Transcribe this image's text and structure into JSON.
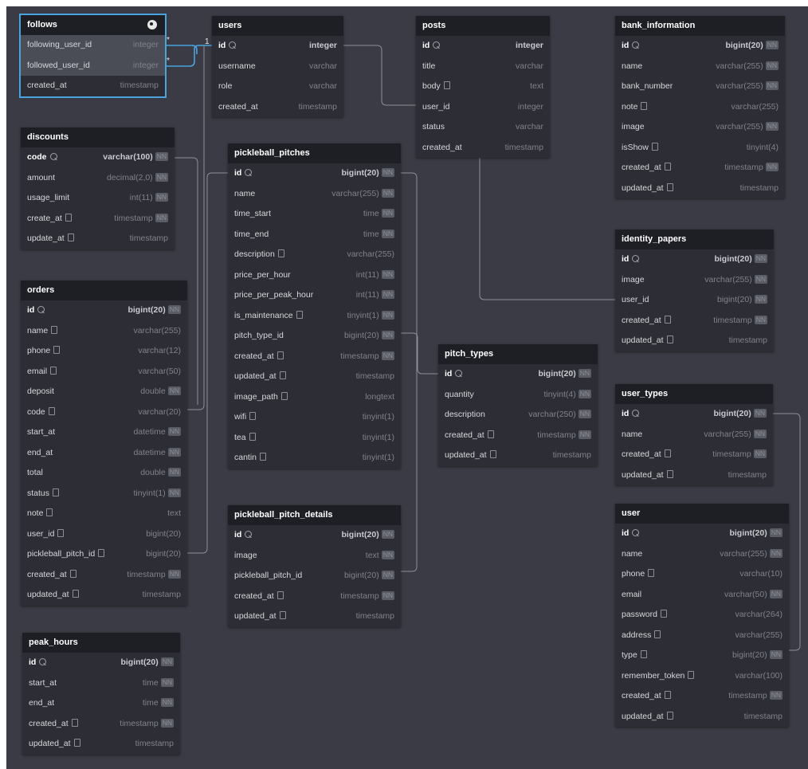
{
  "relation_labels": [
    {
      "text": "*"
    },
    {
      "text": "*"
    },
    {
      "text": "1"
    }
  ],
  "tables": [
    {
      "id": "follows",
      "name": "follows",
      "selected": true,
      "palette_icon": "palette-icon",
      "fields": [
        {
          "name": "following_user_id",
          "type": "integer",
          "highlight": true
        },
        {
          "name": "followed_user_id",
          "type": "integer",
          "highlight": true
        },
        {
          "name": "created_at",
          "type": "timestamp"
        }
      ]
    },
    {
      "id": "users",
      "name": "users",
      "fields": [
        {
          "name": "id",
          "type": "integer",
          "pk": true,
          "key": true
        },
        {
          "name": "username",
          "type": "varchar"
        },
        {
          "name": "role",
          "type": "varchar"
        },
        {
          "name": "created_at",
          "type": "timestamp"
        }
      ]
    },
    {
      "id": "posts",
      "name": "posts",
      "fields": [
        {
          "name": "id",
          "type": "integer",
          "pk": true,
          "key": true
        },
        {
          "name": "title",
          "type": "varchar"
        },
        {
          "name": "body",
          "type": "text",
          "note": true
        },
        {
          "name": "user_id",
          "type": "integer"
        },
        {
          "name": "status",
          "type": "varchar"
        },
        {
          "name": "created_at",
          "type": "timestamp"
        }
      ]
    },
    {
      "id": "bank_information",
      "name": "bank_information",
      "fields": [
        {
          "name": "id",
          "type": "bigint(20)",
          "pk": true,
          "key": true,
          "nn": "NN"
        },
        {
          "name": "name",
          "type": "varchar(255)",
          "nn": "NN"
        },
        {
          "name": "bank_number",
          "type": "varchar(255)",
          "nn": "NN"
        },
        {
          "name": "note",
          "type": "varchar(255)",
          "note": true
        },
        {
          "name": "image",
          "type": "varchar(255)",
          "nn": "NN"
        },
        {
          "name": "isShow",
          "type": "tinyint(4)",
          "note": true
        },
        {
          "name": "created_at",
          "type": "timestamp",
          "note": true,
          "nn": "NN"
        },
        {
          "name": "updated_at",
          "type": "timestamp",
          "note": true
        }
      ]
    },
    {
      "id": "discounts",
      "name": "discounts",
      "fields": [
        {
          "name": "code",
          "type": "varchar(100)",
          "pk": true,
          "key": true,
          "nn": "NN"
        },
        {
          "name": "amount",
          "type": "decimal(2,0)",
          "nn": "NN"
        },
        {
          "name": "usage_limit",
          "type": "int(11)",
          "nn": "NN"
        },
        {
          "name": "create_at",
          "type": "timestamp",
          "note": true,
          "nn": "NN"
        },
        {
          "name": "update_at",
          "type": "timestamp",
          "note": true
        }
      ]
    },
    {
      "id": "pickleball_pitches",
      "name": "pickleball_pitches",
      "fields": [
        {
          "name": "id",
          "type": "bigint(20)",
          "pk": true,
          "key": true,
          "nn": "NN"
        },
        {
          "name": "name",
          "type": "varchar(255)",
          "nn": "NN"
        },
        {
          "name": "time_start",
          "type": "time",
          "nn": "NN"
        },
        {
          "name": "time_end",
          "type": "time",
          "nn": "NN"
        },
        {
          "name": "description",
          "type": "varchar(255)",
          "note": true
        },
        {
          "name": "price_per_hour",
          "type": "int(11)",
          "nn": "NN"
        },
        {
          "name": "price_per_peak_hour",
          "type": "int(11)",
          "nn": "NN"
        },
        {
          "name": "is_maintenance",
          "type": "tinyint(1)",
          "note": true,
          "nn": "NN"
        },
        {
          "name": "pitch_type_id",
          "type": "bigint(20)",
          "nn": "NN"
        },
        {
          "name": "created_at",
          "type": "timestamp",
          "note": true,
          "nn": "NN"
        },
        {
          "name": "updated_at",
          "type": "timestamp",
          "note": true
        },
        {
          "name": "image_path",
          "type": "longtext",
          "note": true
        },
        {
          "name": "wifi",
          "type": "tinyint(1)",
          "note": true
        },
        {
          "name": "tea",
          "type": "tinyint(1)",
          "note": true
        },
        {
          "name": "cantin",
          "type": "tinyint(1)",
          "note": true
        }
      ]
    },
    {
      "id": "identity_papers",
      "name": "identity_papers",
      "fields": [
        {
          "name": "id",
          "type": "bigint(20)",
          "pk": true,
          "key": true,
          "nn": "NN"
        },
        {
          "name": "image",
          "type": "varchar(255)",
          "nn": "NN"
        },
        {
          "name": "user_id",
          "type": "bigint(20)",
          "nn": "NN"
        },
        {
          "name": "created_at",
          "type": "timestamp",
          "note": true,
          "nn": "NN"
        },
        {
          "name": "updated_at",
          "type": "timestamp",
          "note": true
        }
      ]
    },
    {
      "id": "orders",
      "name": "orders",
      "fields": [
        {
          "name": "id",
          "type": "bigint(20)",
          "pk": true,
          "key": true,
          "nn": "NN"
        },
        {
          "name": "name",
          "type": "varchar(255)",
          "note": true
        },
        {
          "name": "phone",
          "type": "varchar(12)",
          "note": true
        },
        {
          "name": "email",
          "type": "varchar(50)",
          "note": true
        },
        {
          "name": "deposit",
          "type": "double",
          "nn": "NN"
        },
        {
          "name": "code",
          "type": "varchar(20)",
          "note": true
        },
        {
          "name": "start_at",
          "type": "datetime",
          "nn": "NN"
        },
        {
          "name": "end_at",
          "type": "datetime",
          "nn": "NN"
        },
        {
          "name": "total",
          "type": "double",
          "nn": "NN"
        },
        {
          "name": "status",
          "type": "tinyint(1)",
          "note": true,
          "nn": "NN"
        },
        {
          "name": "note",
          "type": "text",
          "note": true
        },
        {
          "name": "user_id",
          "type": "bigint(20)",
          "note": true
        },
        {
          "name": "pickleball_pitch_id",
          "type": "bigint(20)",
          "note": true
        },
        {
          "name": "created_at",
          "type": "timestamp",
          "note": true,
          "nn": "NN"
        },
        {
          "name": "updated_at",
          "type": "timestamp",
          "note": true
        }
      ]
    },
    {
      "id": "pitch_types",
      "name": "pitch_types",
      "fields": [
        {
          "name": "id",
          "type": "bigint(20)",
          "pk": true,
          "key": true,
          "nn": "NN"
        },
        {
          "name": "quantity",
          "type": "tinyint(4)",
          "nn": "NN"
        },
        {
          "name": "description",
          "type": "varchar(250)",
          "nn": "NN"
        },
        {
          "name": "created_at",
          "type": "timestamp",
          "note": true,
          "nn": "NN"
        },
        {
          "name": "updated_at",
          "type": "timestamp",
          "note": true
        }
      ]
    },
    {
      "id": "user_types",
      "name": "user_types",
      "fields": [
        {
          "name": "id",
          "type": "bigint(20)",
          "pk": true,
          "key": true,
          "nn": "NN"
        },
        {
          "name": "name",
          "type": "varchar(255)",
          "nn": "NN"
        },
        {
          "name": "created_at",
          "type": "timestamp",
          "note": true,
          "nn": "NN"
        },
        {
          "name": "updated_at",
          "type": "timestamp",
          "note": true
        }
      ]
    },
    {
      "id": "pickleball_pitch_details",
      "name": "pickleball_pitch_details",
      "fields": [
        {
          "name": "id",
          "type": "bigint(20)",
          "pk": true,
          "key": true,
          "nn": "NN"
        },
        {
          "name": "image",
          "type": "text",
          "nn": "NN"
        },
        {
          "name": "pickleball_pitch_id",
          "type": "bigint(20)",
          "nn": "NN"
        },
        {
          "name": "created_at",
          "type": "timestamp",
          "note": true,
          "nn": "NN"
        },
        {
          "name": "updated_at",
          "type": "timestamp",
          "note": true
        }
      ]
    },
    {
      "id": "user",
      "name": "user",
      "fields": [
        {
          "name": "id",
          "type": "bigint(20)",
          "pk": true,
          "key": true,
          "nn": "NN"
        },
        {
          "name": "name",
          "type": "varchar(255)",
          "nn": "NN"
        },
        {
          "name": "phone",
          "type": "varchar(10)",
          "note": true
        },
        {
          "name": "email",
          "type": "varchar(50)",
          "nn": "NN"
        },
        {
          "name": "password",
          "type": "varchar(264)",
          "note": true
        },
        {
          "name": "address",
          "type": "varchar(255)",
          "note": true
        },
        {
          "name": "type",
          "type": "bigint(20)",
          "note": true,
          "nn": "NN"
        },
        {
          "name": "remember_token",
          "type": "varchar(100)",
          "note": true
        },
        {
          "name": "created_at",
          "type": "timestamp",
          "note": true,
          "nn": "NN"
        },
        {
          "name": "updated_at",
          "type": "timestamp",
          "note": true
        }
      ]
    },
    {
      "id": "peak_hours",
      "name": "peak_hours",
      "fields": [
        {
          "name": "id",
          "type": "bigint(20)",
          "pk": true,
          "key": true,
          "nn": "NN"
        },
        {
          "name": "start_at",
          "type": "time",
          "nn": "NN"
        },
        {
          "name": "end_at",
          "type": "time",
          "nn": "NN"
        },
        {
          "name": "created_at",
          "type": "timestamp",
          "note": true,
          "nn": "NN"
        },
        {
          "name": "updated_at",
          "type": "timestamp",
          "note": true
        }
      ]
    }
  ]
}
